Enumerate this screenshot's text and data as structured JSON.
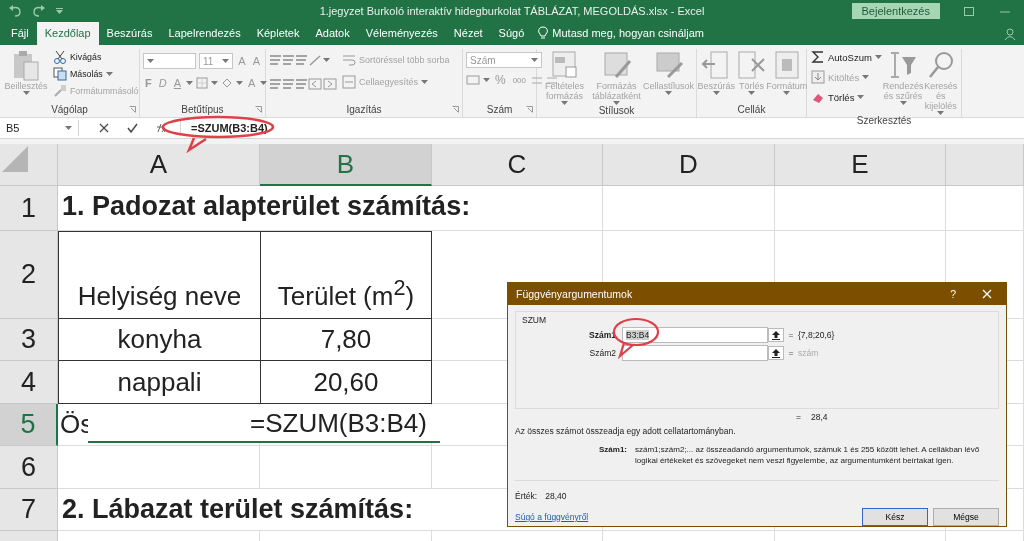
{
  "window": {
    "title": "1.jegyzet Burkoló interaktív hidegburkolat TÁBLÁZAT, MEGOLDÁS.xlsx  -  Excel",
    "sign_in": "Bejelentkezés"
  },
  "tabs": [
    {
      "label": "Fájl",
      "selected": false
    },
    {
      "label": "Kezdőlap",
      "selected": true
    },
    {
      "label": "Beszúrás",
      "selected": false
    },
    {
      "label": "Lapelrendezés",
      "selected": false
    },
    {
      "label": "Képletek",
      "selected": false
    },
    {
      "label": "Adatok",
      "selected": false
    },
    {
      "label": "Véleményezés",
      "selected": false
    },
    {
      "label": "Nézet",
      "selected": false
    },
    {
      "label": "Súgó",
      "selected": false
    }
  ],
  "tell_me": "Mutasd meg, hogyan csináljam",
  "ribbon_groups": [
    {
      "kind": "clipboard",
      "label": "Vágólap",
      "large": [
        {
          "label": "Beillesztés",
          "disabled": true,
          "dropdown": true
        }
      ],
      "small": [
        {
          "label": "Kivágás",
          "disabled": false,
          "dropdown": false
        },
        {
          "label": "Másolás",
          "disabled": false,
          "dropdown": true
        },
        {
          "label": "Formátummásoló",
          "disabled": true,
          "dropdown": false
        }
      ]
    },
    {
      "kind": "font",
      "label": "Betűtípus",
      "size": "11",
      "size_buttons": [
        "A",
        "A"
      ],
      "style_buttons": [
        "F",
        "D",
        "A"
      ],
      "color_button": "A"
    },
    {
      "kind": "alignment",
      "label": "Igazítás",
      "small": [
        {
          "label": "Sortöréssel több sorba",
          "disabled": true,
          "dropdown": false
        },
        {
          "label": "Cellaegyesítés",
          "disabled": true,
          "dropdown": true
        }
      ]
    },
    {
      "kind": "number",
      "label": "Szám",
      "format": "Szám",
      "glyphs": [
        "%",
        "000"
      ]
    },
    {
      "kind": "styles",
      "label": "Stílusok",
      "large": [
        {
          "label": "Feltételes formázás",
          "disabled": true,
          "dropdown": true
        },
        {
          "label": "Formázás táblázatként",
          "disabled": true,
          "dropdown": true
        },
        {
          "label": "Cellastílusok",
          "disabled": true,
          "dropdown": true
        }
      ]
    },
    {
      "kind": "cells",
      "label": "Cellák",
      "large": [
        {
          "label": "Beszúrás",
          "disabled": true,
          "dropdown": true
        },
        {
          "label": "Törlés",
          "disabled": true,
          "dropdown": true
        },
        {
          "label": "Formátum",
          "disabled": true,
          "dropdown": true
        }
      ]
    },
    {
      "kind": "editing",
      "label": "Szerkesztés",
      "small": [
        {
          "label": "AutoSzum",
          "disabled": false,
          "dropdown": true
        },
        {
          "label": "Kitöltés",
          "disabled": true,
          "dropdown": true
        },
        {
          "label": "Törlés",
          "disabled": false,
          "dropdown": true
        }
      ],
      "large": [
        {
          "label": "Rendezés és szűrés",
          "disabled": true,
          "dropdown": true
        },
        {
          "label": "Keresés és kijelölés",
          "disabled": true,
          "dropdown": true
        }
      ]
    }
  ],
  "formula_bar": {
    "name_box": "B5",
    "formula": "=SZUM(B3:B4)"
  },
  "columns": [
    {
      "letter": "A",
      "selected": false
    },
    {
      "letter": "B",
      "selected": true
    },
    {
      "letter": "C",
      "selected": false
    },
    {
      "letter": "D",
      "selected": false
    },
    {
      "letter": "E",
      "selected": false
    }
  ],
  "rows": [
    {
      "number": "1",
      "selected": false,
      "kind": "title",
      "cells": [
        "1. Padozat alapterület számítás:"
      ]
    },
    {
      "number": "2",
      "selected": false,
      "kind": "table",
      "cells": [
        "Helyiség neve",
        "Terület (m$^{2}$)"
      ]
    },
    {
      "number": "3",
      "selected": false,
      "kind": "table",
      "cells": [
        "konyha",
        "7,80"
      ]
    },
    {
      "number": "4",
      "selected": false,
      "kind": "table",
      "cells": [
        "nappali",
        "20,60"
      ]
    },
    {
      "number": "5",
      "selected": true,
      "kind": "edit",
      "cells": [
        "Ös",
        "=SZUM(B3:B4)"
      ]
    },
    {
      "number": "6",
      "selected": false,
      "kind": "empty"
    },
    {
      "number": "7",
      "selected": false,
      "kind": "title",
      "cells": [
        "2. Lábazat terület számítás:"
      ]
    }
  ],
  "dialog": {
    "title": "Függvényargumentumok",
    "help": "?",
    "function": "SZUM",
    "args": [
      {
        "label": "Szám1",
        "value": "B3:B4",
        "equals": "=",
        "result": "{7,8;20,6}",
        "active": true,
        "muted": false
      },
      {
        "label": "Szám2",
        "equals": "=",
        "result": "szám",
        "active": false,
        "muted": true
      }
    ],
    "total_equals": "=",
    "total": "28,4",
    "description": "Az összes számot összeadja egy adott cellatartományban.",
    "arg_help_label": "Szám1:",
    "arg_help": "szám1;szám2;... az összeadandó argumentumok, számuk 1 és 255 között lehet. A cellákban lévő logikai értékeket és szövegeket nem veszi figyelembe, az argumentumként beírtakat igen.",
    "value_label": "Érték:",
    "value": "28,40",
    "help_link": "Súgó a függvényről",
    "buttons": [
      {
        "label": "Kész",
        "default": true
      },
      {
        "label": "Mégse",
        "default": false
      }
    ]
  }
}
